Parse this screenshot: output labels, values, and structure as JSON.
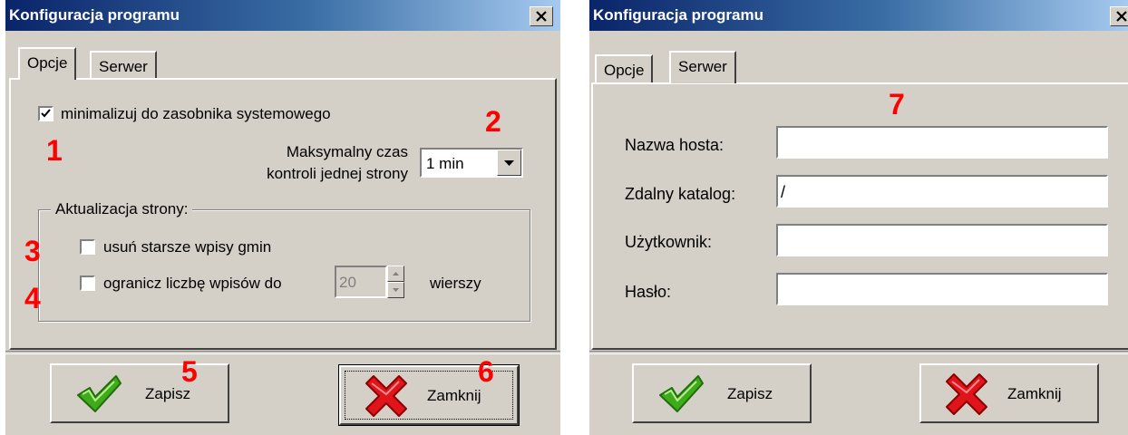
{
  "left_dialog": {
    "title": "Konfiguracja programu",
    "tabs": [
      {
        "label": "Opcje",
        "active": true
      },
      {
        "label": "Serwer",
        "active": false
      }
    ],
    "minimize_checkbox": {
      "label": "minimalizuj do zasobnika systemowego",
      "checked": true
    },
    "max_time": {
      "label_line1": "Maksymalny czas",
      "label_line2": "kontroli jednej strony",
      "value": "1 min"
    },
    "group": {
      "label": "Aktualizacja strony:",
      "delete_old": {
        "label": "usuń starsze wpisy gmin",
        "checked": false
      },
      "limit": {
        "label": "ogranicz liczbę wpisów do",
        "value": "20",
        "suffix": "wierszy",
        "checked": false
      }
    },
    "buttons": {
      "save": "Zapisz",
      "close": "Zamknij"
    },
    "markers": {
      "m1": "1",
      "m2": "2",
      "m3": "3",
      "m4": "4",
      "m5": "5",
      "m6": "6"
    }
  },
  "right_dialog": {
    "title": "Konfiguracja programu",
    "tabs": [
      {
        "label": "Opcje",
        "active": false
      },
      {
        "label": "Serwer",
        "active": true
      }
    ],
    "fields": [
      {
        "label": "Nazwa hosta:",
        "value": ""
      },
      {
        "label": "Zdalny katalog:",
        "value": "/"
      },
      {
        "label": "Użytkownik:",
        "value": ""
      },
      {
        "label": "Hasło:",
        "value": ""
      }
    ],
    "buttons": {
      "save": "Zapisz",
      "close": "Zamknij"
    },
    "markers": {
      "m7": "7"
    }
  },
  "icons": {
    "check": "green-checkmark-icon",
    "cross": "red-x-icon",
    "close": "close-x-icon",
    "dropdown": "dropdown-arrow-icon"
  },
  "colors": {
    "title_gradient_start": "#0a246a",
    "title_gradient_end": "#a6caf0",
    "window_bg": "#d4d0c8",
    "marker": "#ff0000",
    "check_icon": "#3faa1a",
    "cross_icon": "#e0141a"
  }
}
